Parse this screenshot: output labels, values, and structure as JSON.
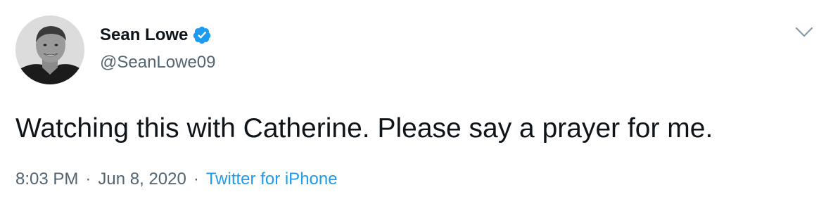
{
  "author": {
    "display_name": "Sean Lowe",
    "handle": "@SeanLowe09",
    "verified": true,
    "avatar_icon": "profile-photo"
  },
  "tweet": {
    "text": "Watching this with Catherine. Please say a prayer for me.",
    "time": "8:03 PM",
    "separator": "·",
    "date": "Jun 8, 2020",
    "source": "Twitter for iPhone"
  },
  "icons": {
    "verified": "verified-badge-icon",
    "menu": "chevron-down-icon"
  },
  "colors": {
    "text": "#0f1419",
    "muted": "#536471",
    "link": "#1d9bf0",
    "verified": "#1d9bf0"
  }
}
